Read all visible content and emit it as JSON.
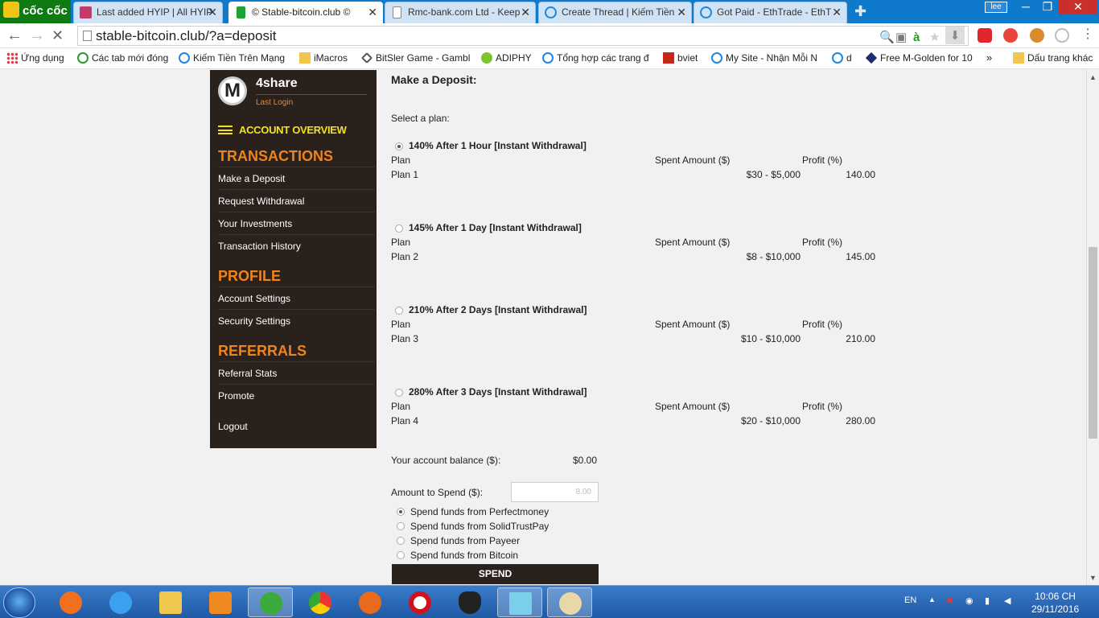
{
  "browser": {
    "logo": "cốc cốc",
    "tabs": [
      {
        "title": "Last added HYIP | All HYIP",
        "active": false
      },
      {
        "title": "© Stable-bitcoin.club ©",
        "active": true
      },
      {
        "title": "Rmc-bank.com Ltd - Keep",
        "active": false
      },
      {
        "title": "Create Thread | Kiếm Tiền",
        "active": false
      },
      {
        "title": "Got Paid - EthTrade - EthT",
        "active": false
      }
    ],
    "user": "lee",
    "url": "stable-bitcoin.club/?a=deposit",
    "bookmarks": [
      "Ứng dụng",
      "Các tab mới đóng",
      "Kiếm Tiền Trên Mạng",
      "iMacros",
      "BitSler Game - Gambl",
      "ADIPHY",
      "Tổng hợp các trang đ",
      "bviet",
      "My Site - Nhận Mỗi N",
      "d",
      "Free M-Golden for 10",
      "»",
      "Dấu trang khác"
    ]
  },
  "sidebar": {
    "logo_letter": "M",
    "username": "4share",
    "last_login": "Last Login",
    "account_overview": "ACCOUNT OVERVIEW",
    "sections": [
      {
        "title": "TRANSACTIONS",
        "items": [
          "Make a Deposit",
          "Request Withdrawal",
          "Your Investments",
          "Transaction History"
        ]
      },
      {
        "title": "PROFILE",
        "items": [
          "Account Settings",
          "Security Settings"
        ]
      },
      {
        "title": "REFERRALS",
        "items": [
          "Referral Stats",
          "Promote"
        ]
      }
    ],
    "logout": "Logout"
  },
  "deposit": {
    "title": "Make a Deposit:",
    "select_label": "Select a plan:",
    "col_plan": "Plan",
    "col_spent": "Spent Amount ($)",
    "col_profit": "Profit (%)",
    "plans": [
      {
        "name": "140% After 1 Hour [Instant Withdrawal]",
        "plan": "Plan 1",
        "range": "$30 - $5,000",
        "profit": "140.00",
        "selected": true
      },
      {
        "name": "145% After 1 Day [Instant Withdrawal]",
        "plan": "Plan 2",
        "range": "$8 - $10,000",
        "profit": "145.00",
        "selected": false
      },
      {
        "name": "210% After 2 Days [Instant Withdrawal]",
        "plan": "Plan 3",
        "range": "$10 - $10,000",
        "profit": "210.00",
        "selected": false
      },
      {
        "name": "280% After 3 Days [Instant Withdrawal]",
        "plan": "Plan 4",
        "range": "$20 - $10,000",
        "profit": "280.00",
        "selected": false
      }
    ],
    "balance_label": "Your account balance ($):",
    "balance_value": "$0.00",
    "amount_label": "Amount to Spend ($):",
    "amount_value": "8.00",
    "payment_options": [
      {
        "label": "Spend funds from Perfectmoney",
        "selected": true
      },
      {
        "label": "Spend funds from SolidTrustPay",
        "selected": false
      },
      {
        "label": "Spend funds from Payeer",
        "selected": false
      },
      {
        "label": "Spend funds from Bitcoin",
        "selected": false
      }
    ],
    "spend_button": "SPEND"
  },
  "taskbar": {
    "lang": "EN",
    "time": "10:06 CH",
    "date": "29/11/2016"
  }
}
